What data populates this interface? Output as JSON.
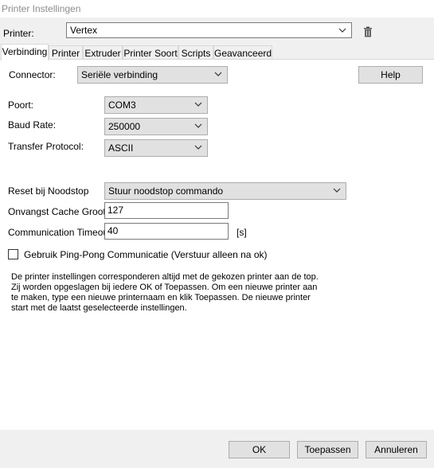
{
  "window": {
    "title": "Printer Instellingen"
  },
  "printer": {
    "label": "Printer:",
    "selected": "Vertex",
    "delete_icon": "trash-icon"
  },
  "tabs": [
    {
      "label": "Verbinding",
      "active": true
    },
    {
      "label": "Printer"
    },
    {
      "label": "Extruder"
    },
    {
      "label": "Printer Soort"
    },
    {
      "label": "Scripts"
    },
    {
      "label": "Geavanceerd"
    }
  ],
  "connection": {
    "connector_label": "Connector:",
    "connector_value": "Seriële verbinding",
    "help_label": "Help",
    "port_label": "Poort:",
    "port_value": "COM3",
    "baud_label": "Baud Rate:",
    "baud_value": "250000",
    "protocol_label": "Transfer Protocol:",
    "protocol_value": "ASCII",
    "reset_label": "Reset bij Noodstop",
    "reset_value": "Stuur noodstop commando",
    "cache_label": "Onvangst Cache Grootte",
    "cache_value": "127",
    "timeout_label": "Communication Timeout:",
    "timeout_value": "40",
    "timeout_unit": "[s]",
    "pingpong_label": "Gebruik Ping-Pong Communicatie (Verstuur alleen na ok)",
    "pingpong_checked": false,
    "description_lines": [
      "De printer instellingen corresponderen altijd met de gekozen printer aan de top.",
      "Zij worden opgeslagen bij iedere OK of Toepassen. Om een nieuwe printer aan",
      "te maken, type een nieuwe printernaam en klik Toepassen. De nieuwe printer",
      "start met de laatst geselecteerde instellingen."
    ]
  },
  "footer": {
    "ok_label": "OK",
    "apply_label": "Toepassen",
    "cancel_label": "Annuleren"
  }
}
